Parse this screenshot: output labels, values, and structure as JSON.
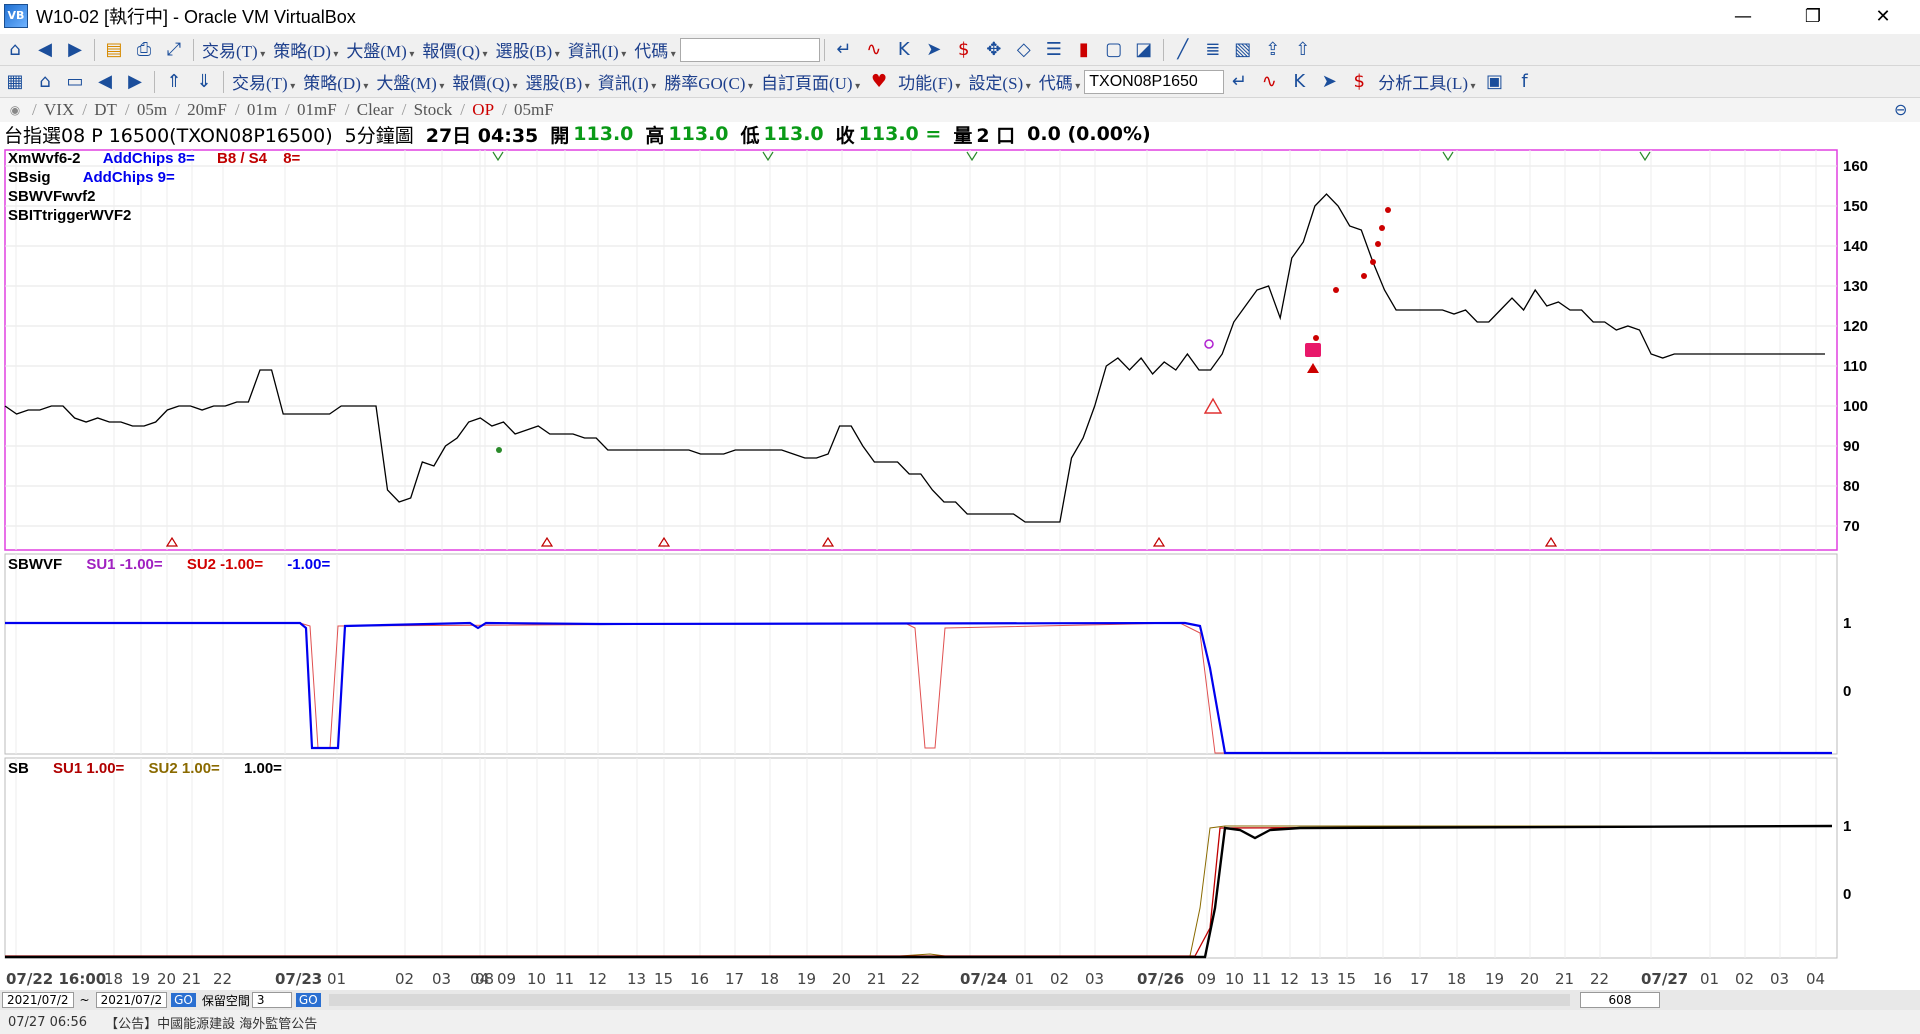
{
  "window": {
    "title": "W10-02 [執行中] - Oracle VM VirtualBox",
    "min": "—",
    "max": "❐",
    "close": "✕"
  },
  "toolbar1": {
    "menus": [
      "交易(T)",
      "策略(D)",
      "大盤(M)",
      "報價(Q)",
      "選股(B)",
      "資訊(I)"
    ],
    "code_label": "代碼"
  },
  "toolbar2": {
    "menus": [
      "交易(T)",
      "策略(D)",
      "大盤(M)",
      "報價(Q)",
      "選股(B)",
      "資訊(I)",
      "勝率GO(C)",
      "自訂頁面(U)"
    ],
    "menus2": [
      "功能(F)",
      "設定(S)"
    ],
    "code_label": "代碼",
    "code_value": "TXON08P1650",
    "analysis": "分析工具(L)"
  },
  "tabs": [
    "VIX",
    "DT",
    "05m",
    "20mF",
    "01m",
    "01mF",
    "Clear",
    "Stock",
    "OP",
    "05mF"
  ],
  "info": {
    "symbol": "台指選08 P 16500(TXON08P16500)",
    "period": "5分鐘圖",
    "datetime": "27日 04:35",
    "open_label": "開",
    "open": "113.0",
    "high_label": "高",
    "high": "113.0",
    "low_label": "低",
    "low": "113.0",
    "close_label": "收",
    "close": "113.0 =",
    "vol_label": "量",
    "vol": "2 口",
    "change": "0.0 (0.00%)"
  },
  "panel1": {
    "legend": [
      {
        "text": "XmWvf6-2",
        "color": "#000000"
      },
      {
        "text": "AddChips 8=",
        "color": "#0000ee"
      },
      {
        "text": "B8 / S4",
        "color": "#c00000"
      },
      {
        "text": "8=",
        "color": "#c00000"
      }
    ],
    "legend2": [
      {
        "text": "SBsig",
        "color": "#000000"
      },
      {
        "text": "AddChips 9=",
        "color": "#0000ee"
      }
    ],
    "legend3": "SBWVFwvf2",
    "legend4": "SBITtriggerWVF2",
    "y_ticks": [
      "160",
      "150",
      "140",
      "130",
      "120",
      "110",
      "100",
      "90",
      "80",
      "70"
    ]
  },
  "panel2": {
    "legend": [
      {
        "text": "SBWVF",
        "color": "#000000"
      },
      {
        "text": "SU1 -1.00=",
        "color": "#a020c0"
      },
      {
        "text": "SU2 -1.00=",
        "color": "#d00000"
      },
      {
        "text": "-1.00=",
        "color": "#0000ee"
      }
    ],
    "y_ticks": [
      "1",
      "0"
    ]
  },
  "panel3": {
    "legend": [
      {
        "text": "SB",
        "color": "#000000"
      },
      {
        "text": "SU1 1.00=",
        "color": "#b00000"
      },
      {
        "text": "SU2 1.00=",
        "color": "#8a6a00"
      },
      {
        "text": "1.00=",
        "color": "#000000"
      }
    ],
    "y_ticks": [
      "1",
      "0"
    ]
  },
  "x_ticks": [
    "07/22 16:00",
    "18",
    "19",
    "20",
    "21",
    "22",
    "07/23",
    "01",
    "02",
    "03",
    "04",
    "08",
    "09",
    "10",
    "11",
    "12",
    "13",
    "15",
    "16",
    "17",
    "18",
    "19",
    "20",
    "21",
    "22",
    "07/24",
    "01",
    "02",
    "03",
    "07/26",
    "09",
    "10",
    "11",
    "12",
    "13",
    "15",
    "16",
    "17",
    "18",
    "19",
    "20",
    "21",
    "22",
    "07/27",
    "01",
    "02",
    "03",
    "04"
  ],
  "bottombar": {
    "date1": "2021/07/2",
    "tilde": "~",
    "date2": "2021/07/2",
    "go": "GO",
    "reserve": "保留空間",
    "reserve_val": "3",
    "go2": "GO",
    "count": "608"
  },
  "status": {
    "time": "07/27 06:56",
    "news": "【公告】中國能源建設 海外監管公告"
  },
  "chart_data": {
    "type": "line",
    "series": [
      {
        "y": [
          100,
          98,
          99,
          99,
          100,
          100,
          97,
          96,
          97,
          96,
          96,
          95,
          95,
          96,
          99,
          100,
          100,
          99,
          100,
          100,
          101,
          101,
          109,
          109,
          98,
          98,
          98,
          98,
          98,
          100,
          100,
          100,
          100,
          79,
          76,
          77,
          86,
          85,
          90,
          92,
          96,
          97,
          95,
          96,
          93,
          94,
          95,
          93,
          93,
          93,
          92,
          92,
          89,
          89,
          89,
          89,
          89,
          89,
          89,
          89,
          88,
          88,
          88,
          89,
          89,
          89,
          89,
          89,
          88,
          87,
          87,
          88,
          95,
          95,
          90,
          86,
          86,
          86,
          83,
          83,
          79,
          76,
          76,
          73,
          73,
          73,
          73,
          73,
          71,
          71,
          71,
          71,
          87,
          92,
          100,
          110,
          112,
          109,
          112,
          108,
          111,
          109,
          113,
          109,
          109,
          113,
          121,
          125,
          129,
          130,
          122,
          137,
          141,
          150,
          153,
          150,
          145,
          144,
          136,
          129,
          124,
          124,
          124,
          124,
          124,
          123,
          124,
          121,
          121,
          124,
          127,
          124,
          129,
          125,
          126,
          124,
          124,
          121,
          121,
          119,
          120,
          119,
          113,
          112,
          113,
          113,
          113,
          113,
          113,
          113,
          113,
          113,
          113,
          113,
          113,
          113,
          113,
          113
        ]
      },
      {
        "name": "SU1",
        "y": [
          0
        ]
      },
      {
        "name": "SU2",
        "y": [
          0
        ]
      }
    ],
    "ylim": [
      64,
      164
    ]
  }
}
